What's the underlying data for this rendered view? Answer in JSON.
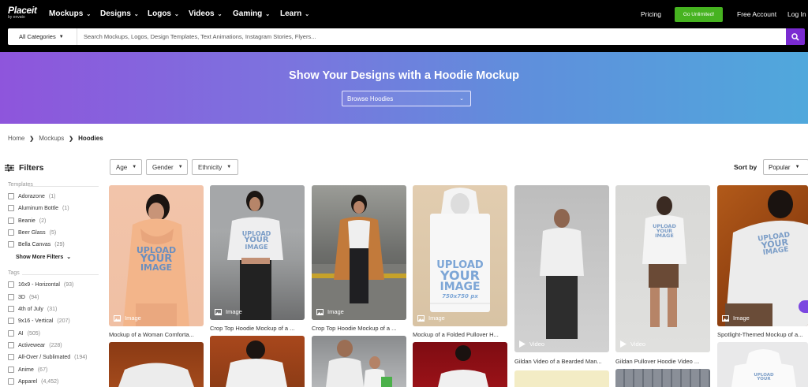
{
  "brand": {
    "name": "Placeit",
    "sub": "by envato"
  },
  "nav": {
    "items": [
      {
        "label": "Mockups"
      },
      {
        "label": "Designs"
      },
      {
        "label": "Logos"
      },
      {
        "label": "Videos"
      },
      {
        "label": "Gaming"
      },
      {
        "label": "Learn"
      }
    ],
    "pricing": "Pricing",
    "unlimited": "Go Unlimited!",
    "free_account": "Free Account",
    "login": "Log In"
  },
  "search": {
    "category": "All Categories",
    "placeholder": "Search Mockups, Logos, Design Templates, Text Animations, Instagram Stories, Flyers..."
  },
  "hero": {
    "title": "Show Your Designs with a Hoodie Mockup",
    "browse": "Browse Hoodies"
  },
  "breadcrumb": [
    "Home",
    "Mockups",
    "Hoodies"
  ],
  "sidebar": {
    "title": "Filters",
    "templates_label": "Templates",
    "templates": [
      {
        "label": "Adorazone",
        "count": "(1)"
      },
      {
        "label": "Aluminum Bottle",
        "count": "(1)"
      },
      {
        "label": "Beanie",
        "count": "(2)"
      },
      {
        "label": "Beer Glass",
        "count": "(5)"
      },
      {
        "label": "Bella Canvas",
        "count": "(29)"
      }
    ],
    "show_more": "Show More Filters",
    "tags_label": "Tags",
    "tags": [
      {
        "label": "16x9 - Horizontal",
        "count": "(93)"
      },
      {
        "label": "3D",
        "count": "(94)"
      },
      {
        "label": "4th of July",
        "count": "(31)"
      },
      {
        "label": "9x16 - Vertical",
        "count": "(207)"
      },
      {
        "label": "AI",
        "count": "(505)"
      },
      {
        "label": "Activewear",
        "count": "(228)"
      },
      {
        "label": "All-Over / Sublimated",
        "count": "(194)"
      },
      {
        "label": "Anime",
        "count": "(67)"
      },
      {
        "label": "Apparel",
        "count": "(4,452)"
      }
    ]
  },
  "filters": {
    "age": "Age",
    "gender": "Gender",
    "ethnicity": "Ethnicity"
  },
  "sort": {
    "label": "Sort by",
    "value": "Popular"
  },
  "upload_text": {
    "l1": "UPLOAD",
    "l2": "YOUR",
    "l3": "IMAGE",
    "size": "750x750 px"
  },
  "cards": [
    {
      "type": "Image",
      "title": "Mockup of a Woman Comforta..."
    },
    {
      "type": "Image",
      "title": "Crop Top Hoodie Mockup of a ..."
    },
    {
      "type": "Image",
      "title": "Crop Top Hoodie Mockup of a ..."
    },
    {
      "type": "Image",
      "title": "Mockup of a Folded Pullover H..."
    },
    {
      "type": "Video",
      "title": "Gildan Video of a Bearded Man..."
    },
    {
      "type": "Video",
      "title": "Gildan Pullover Hoodie Video ..."
    },
    {
      "type": "Image",
      "title": "Spotlight-Themed Mockup of a..."
    }
  ]
}
